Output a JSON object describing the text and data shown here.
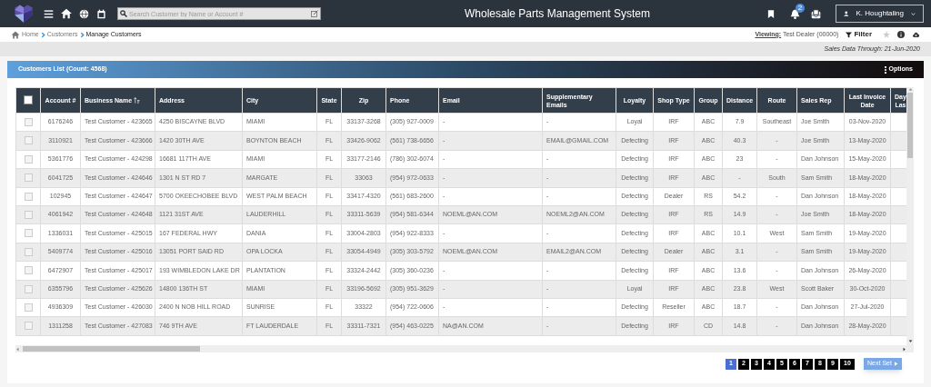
{
  "header": {
    "title": "Wholesale Parts Management System",
    "search_placeholder": "Search Customer by Name or Account #",
    "notification_count": "2",
    "user": "K. Houghtaling"
  },
  "breadcrumb": [
    "Home",
    "Customers",
    "Manage Customers"
  ],
  "viewing": {
    "label": "Viewing:",
    "value": "Test Dealer (00000)"
  },
  "filter": "Filter",
  "sales_data": "Sales Data Through: 21-Jun-2020",
  "panel": {
    "title": "Customers List (Count: 4568)",
    "options": "Options"
  },
  "table": {
    "header_checked": false,
    "columns": [
      {
        "label": "Account #",
        "sorted": false
      },
      {
        "label": "Business Name",
        "sorted": true
      },
      {
        "label": "Address",
        "sorted": false
      },
      {
        "label": "City",
        "sorted": false
      },
      {
        "label": "State",
        "sorted": false
      },
      {
        "label": "Zip",
        "sorted": false
      },
      {
        "label": "Phone",
        "sorted": false
      },
      {
        "label": "Email",
        "sorted": false
      },
      {
        "label": "Supplementary Emails",
        "sorted": false
      },
      {
        "label": "Loyalty",
        "sorted": false
      },
      {
        "label": "Shop Type",
        "sorted": false
      },
      {
        "label": "Group",
        "sorted": false
      },
      {
        "label": "Distance",
        "sorted": false
      },
      {
        "label": "Route",
        "sorted": false
      },
      {
        "label": "Sales Rep",
        "sorted": false
      },
      {
        "label": "Last Invoice Date",
        "sorted": false
      },
      {
        "label": "Day Las",
        "sorted": false
      }
    ],
    "rows": [
      {
        "checked": false,
        "cells": [
          "6176246",
          "Test Customer - 423665",
          "4250 BISCAYNE BLVD",
          "MIAMI",
          "FL",
          "33137-3268",
          "(305) 927-0009",
          "-",
          "-",
          "Loyal",
          "IRF",
          "ABC",
          "7.9",
          "Southeast",
          "Joe Smith",
          "03-Nov-2020"
        ]
      },
      {
        "checked": false,
        "cells": [
          "3110921",
          "Test Customer - 423666",
          "1420 30TH AVE",
          "BOYNTON BEACH",
          "FL",
          "33426-9062",
          "(561) 738-6656",
          "-",
          "EMAIL@GMAIL.COM",
          "Defecting",
          "IRF",
          "ABC",
          "40.3",
          "-",
          "Joe Smith",
          "13-May-2020"
        ]
      },
      {
        "checked": false,
        "cells": [
          "5361776",
          "Test Customer - 424298",
          "16681 117TH AVE",
          "MIAMI",
          "FL",
          "33177-2146",
          "(786) 302-6074",
          "-",
          "-",
          "Defecting",
          "IRF",
          "ABC",
          "23",
          "-",
          "Dan Johnson",
          "15-May-2020"
        ]
      },
      {
        "checked": false,
        "cells": [
          "6041725",
          "Test Customer - 424646",
          "1301 N ST RD 7",
          "MARGATE",
          "FL",
          "33063",
          "(954) 972-0633",
          "-",
          "-",
          "Defecting",
          "IRF",
          "ABC",
          "-",
          "South",
          "Sam Smith",
          "18-May-2020"
        ]
      },
      {
        "checked": false,
        "cells": [
          "102945",
          "Test Customer - 424647",
          "5700 OKEECHOBEE BLVD",
          "WEST PALM BEACH",
          "FL",
          "33417-4320",
          "(561) 683-2600",
          "-",
          "-",
          "Defecting",
          "Dealer",
          "RS",
          "54.2",
          "-",
          "Dan Johnson",
          "18-May-2020"
        ]
      },
      {
        "checked": false,
        "cells": [
          "4061942",
          "Test Customer - 424648",
          "1121 31ST AVE",
          "LAUDERHILL",
          "FL",
          "33311-5639",
          "(954) 581-6344",
          "NOEML@AN.COM",
          "NOEML2@AN.COM",
          "Defecting",
          "IRF",
          "RS",
          "14.9",
          "-",
          "Joe Smith",
          "18-May-2020"
        ]
      },
      {
        "checked": false,
        "cells": [
          "1336031",
          "Test Customer - 425015",
          "167 FEDERAL HWY",
          "DANIA",
          "FL",
          "33004-2803",
          "(954) 922-8333",
          "-",
          "-",
          "Defecting",
          "IRF",
          "ABC",
          "10.1",
          "West",
          "Sam Smith",
          "19-May-2020"
        ]
      },
      {
        "checked": false,
        "cells": [
          "5409774",
          "Test Customer - 425016",
          "13051 PORT SAID RD",
          "OPA LOCKA",
          "FL",
          "33054-4949",
          "(305) 303-5792",
          "NOEML@AN.COM",
          "EMAIL2@AN.COM",
          "Defecting",
          "Dealer",
          "ABC",
          "3.1",
          "-",
          "Sam Smith",
          "19-May-2020"
        ]
      },
      {
        "checked": false,
        "cells": [
          "6472907",
          "Test Customer - 425017",
          "193 WIMBLEDON LAKE DR",
          "PLANTATION",
          "FL",
          "33324-2442",
          "(305) 360-0236",
          "-",
          "-",
          "Defecting",
          "IRF",
          "ABC",
          "13.6",
          "-",
          "Dan Johnson",
          "26-May-2020"
        ]
      },
      {
        "checked": false,
        "cells": [
          "6355796",
          "Test Customer - 425626",
          "14800 136TH ST",
          "MIAMI",
          "FL",
          "33196-5692",
          "(305) 951-3629",
          "-",
          "-",
          "Loyal",
          "IRF",
          "ABC",
          "23.8",
          "West",
          "Scott Baker",
          "30-Oct-2020"
        ]
      },
      {
        "checked": false,
        "cells": [
          "4936309",
          "Test Customer - 426030",
          "2400 N NOB HILL ROAD",
          "SUNRISE",
          "FL",
          "33322",
          "(954) 722-0606",
          "-",
          "-",
          "Defecting",
          "Reseller",
          "ABC",
          "18.7",
          "-",
          "Dan Johnson",
          "27-Jul-2020"
        ]
      },
      {
        "checked": false,
        "cells": [
          "1311258",
          "Test Customer - 427083",
          "746 9TH AVE",
          "FT LAUDERDALE",
          "FL",
          "33311-7321",
          "(954) 463-0225",
          "NA@AN.COM",
          "-",
          "Defecting",
          "IRF",
          "CD",
          "14.8",
          "-",
          "Dan Johnson",
          "28-May-2020"
        ]
      }
    ]
  },
  "pagination": {
    "pages": [
      {
        "label": "1",
        "selected": true
      },
      {
        "label": "2",
        "selected": false
      },
      {
        "label": "3",
        "selected": false
      },
      {
        "label": "4",
        "selected": false
      },
      {
        "label": "5",
        "selected": false
      },
      {
        "label": "6",
        "selected": false
      },
      {
        "label": "7",
        "selected": false
      },
      {
        "label": "8",
        "selected": false
      },
      {
        "label": "9",
        "selected": false
      },
      {
        "label": "10",
        "selected": false
      }
    ],
    "next": "Next Set"
  }
}
